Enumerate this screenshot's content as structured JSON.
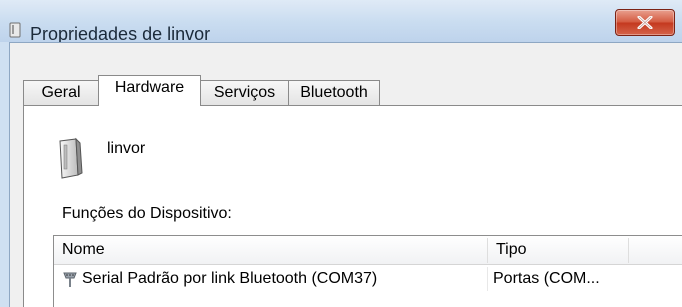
{
  "window": {
    "title": "Propriedades de linvor",
    "close_icon": "close-x-icon"
  },
  "tabs": [
    {
      "label": "Geral",
      "active": false
    },
    {
      "label": "Hardware",
      "active": true
    },
    {
      "label": "Serviços",
      "active": false
    },
    {
      "label": "Bluetooth",
      "active": false
    }
  ],
  "device": {
    "icon": "device-icon",
    "name": "linvor"
  },
  "functions": {
    "label": "Funções do Dispositivo:",
    "columns": {
      "name": "Nome",
      "type": "Tipo"
    },
    "rows": [
      {
        "icon": "serial-port-icon",
        "name": "Serial Padrão por link Bluetooth (COM37)",
        "type": "Portas (COM..."
      }
    ]
  }
}
